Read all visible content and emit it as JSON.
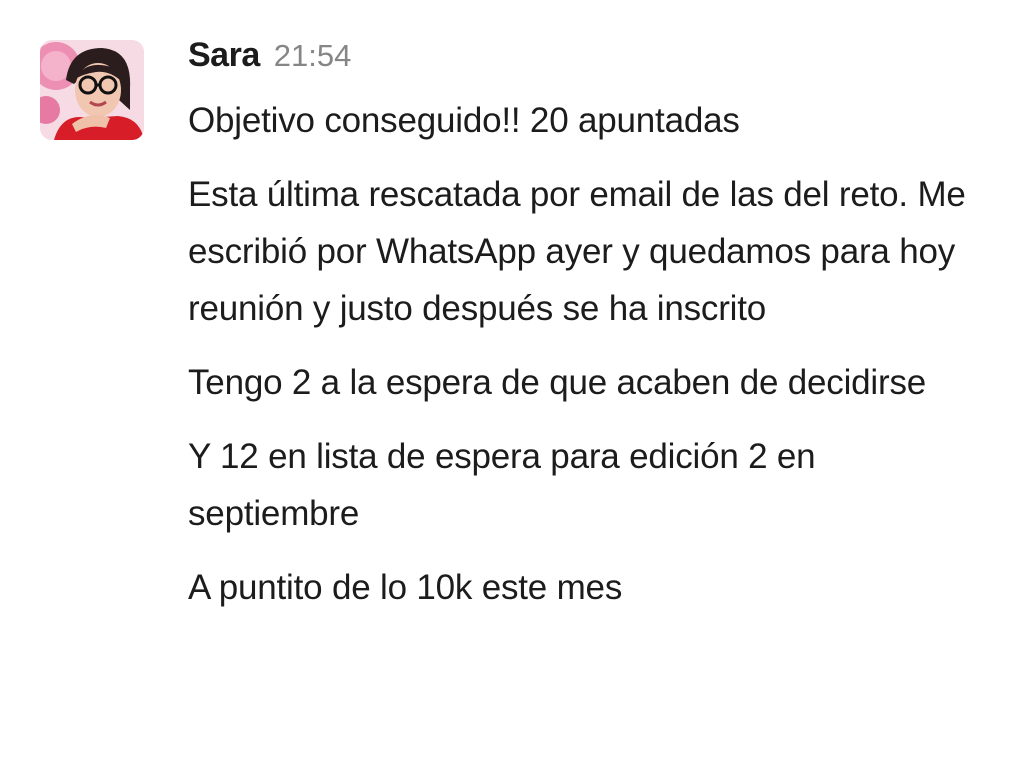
{
  "message": {
    "author": "Sara",
    "timestamp": "21:54",
    "avatar_icon": "user-avatar-photo",
    "paragraphs": [
      "Objetivo conseguido!! 20 apuntadas",
      "Esta última rescatada por email de las del reto. Me escribió por WhatsApp ayer y quedamos para hoy reunión y justo después se ha inscrito",
      "Tengo 2 a la espera de que acaben de decidirse",
      "Y 12 en lista de espera para edición 2 en septiembre",
      "A puntito de lo 10k este mes"
    ]
  },
  "colors": {
    "text": "#1d1c1d",
    "timestamp": "#868686",
    "background": "#ffffff"
  }
}
